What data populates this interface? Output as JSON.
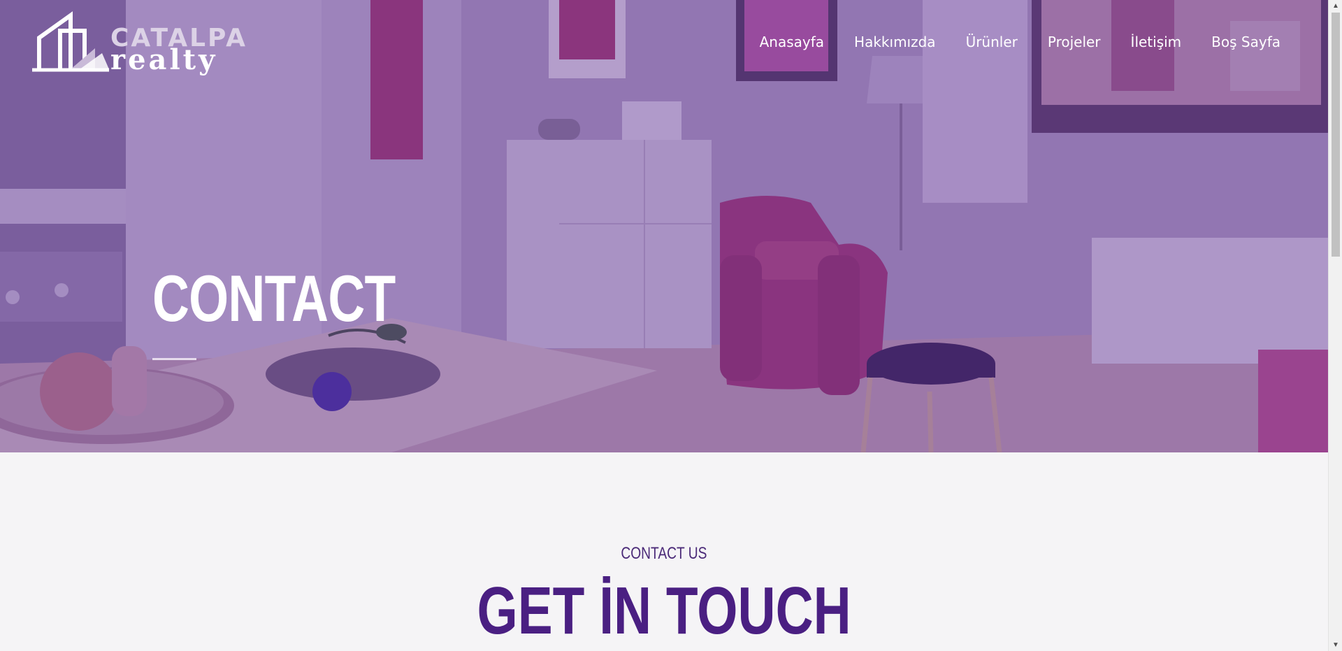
{
  "logo": {
    "word1": "CATALPA",
    "word2": "realty"
  },
  "nav": {
    "items": [
      {
        "label": "Anasayfa"
      },
      {
        "label": "Hakkımızda"
      },
      {
        "label": "Ürünler"
      },
      {
        "label": "Projeler"
      },
      {
        "label": "İletişim"
      },
      {
        "label": "Boş Sayfa"
      }
    ]
  },
  "hero": {
    "title": "CONTACT"
  },
  "content": {
    "eyebrow": "CONTACT US",
    "heading": "GET İN TOUCH"
  },
  "colors": {
    "accent": "#4a1f82",
    "overlay": "#623896",
    "background": "#f5f4f6"
  }
}
